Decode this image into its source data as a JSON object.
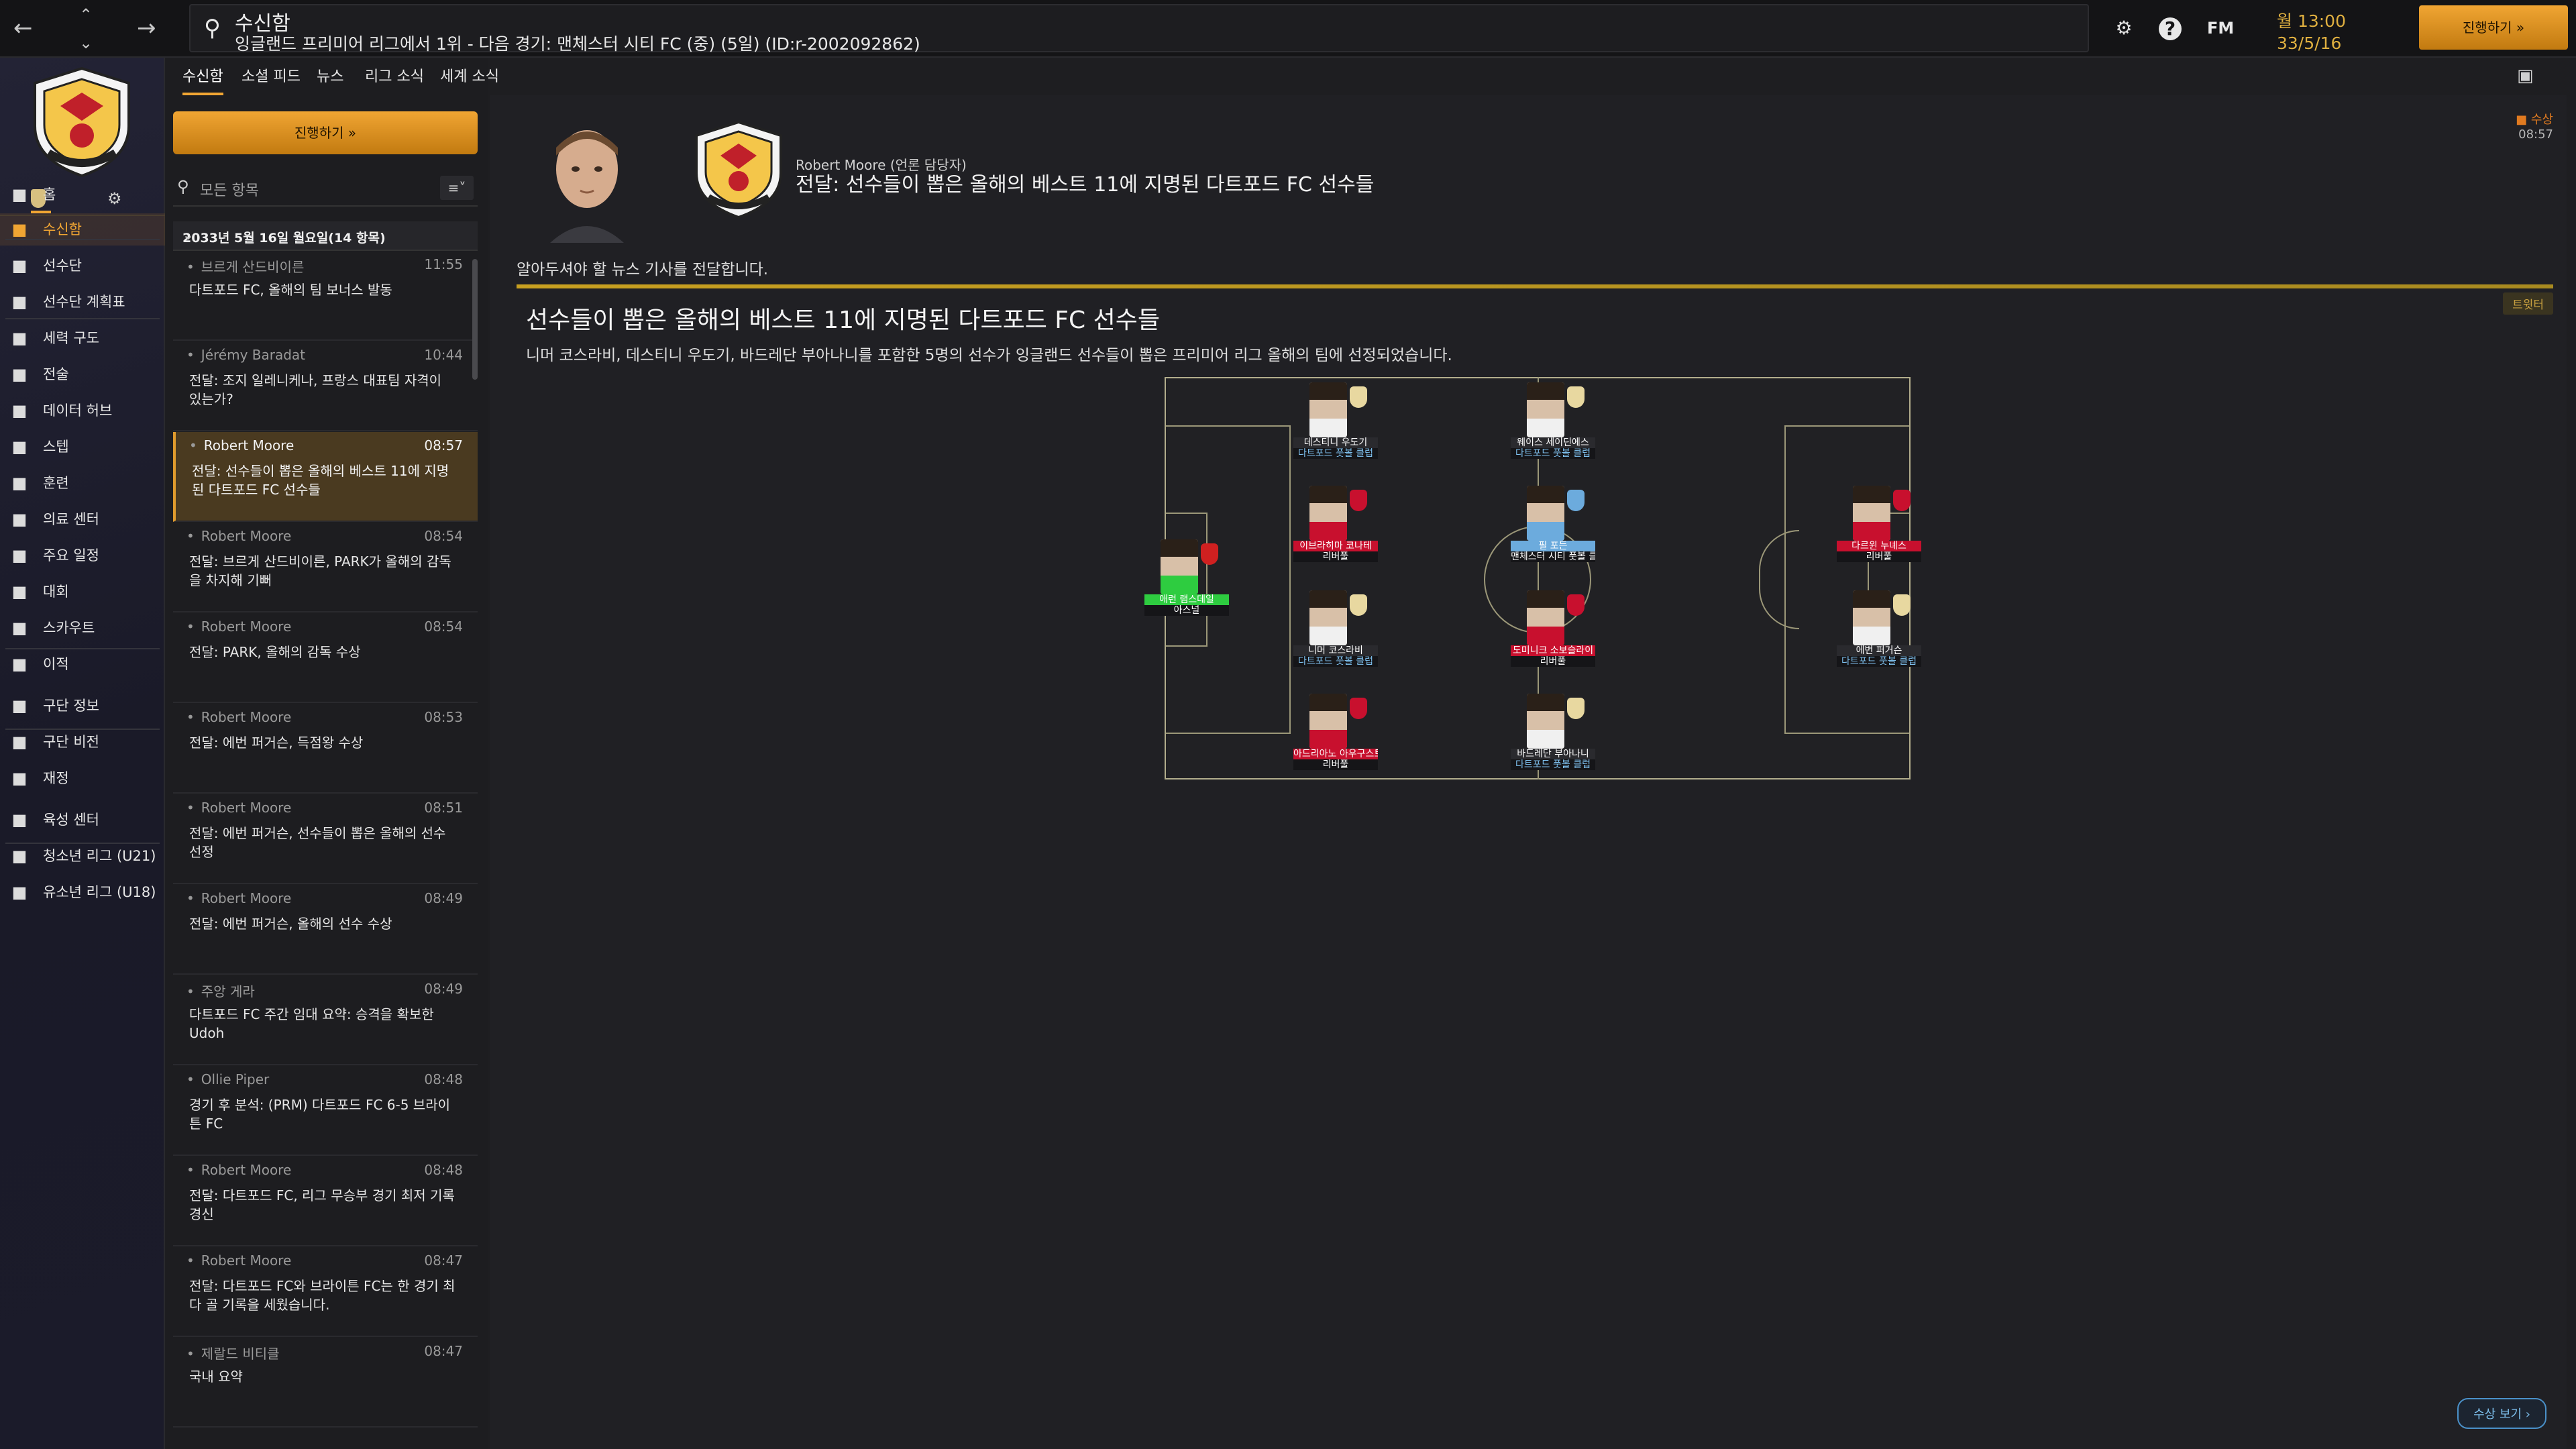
{
  "topbar": {
    "title": "수신함",
    "subtitle": "잉글랜드 프리미어 리그에서 1위 - 다음 경기: 맨체스터 시티 FC (중) (5일) (ID:r-2002092862)",
    "fm_logo": "FM",
    "date_time": "월 13:00",
    "date_day": "33/5/16",
    "continue_label": "진행하기 »"
  },
  "nav": {
    "items": [
      {
        "label": "홈",
        "icon": "home-icon"
      },
      {
        "label": "수신함",
        "icon": "inbox-icon"
      },
      {
        "label": "선수단",
        "icon": "shirt-icon"
      },
      {
        "label": "선수단 계획표",
        "icon": "clipboard-icon"
      },
      {
        "label": "세력 구도",
        "icon": "dynamics-icon"
      },
      {
        "label": "전술",
        "icon": "tactics-icon"
      },
      {
        "label": "데이터 허브",
        "icon": "data-icon"
      },
      {
        "label": "스텝",
        "icon": "staff-icon"
      },
      {
        "label": "훈련",
        "icon": "training-icon"
      },
      {
        "label": "의료 센터",
        "icon": "medical-icon"
      },
      {
        "label": "주요 일정",
        "icon": "calendar-icon"
      },
      {
        "label": "대회",
        "icon": "trophy-icon"
      },
      {
        "label": "스카우트",
        "icon": "scout-icon"
      },
      {
        "label": "이적",
        "icon": "transfer-icon"
      },
      {
        "label": "구단 정보",
        "icon": "shield-icon"
      },
      {
        "label": "구단 비전",
        "icon": "vision-icon"
      },
      {
        "label": "재정",
        "icon": "finance-icon"
      },
      {
        "label": "육성 센터",
        "icon": "development-icon"
      },
      {
        "label": "청소년 리그 (U21)",
        "icon": "u21-icon"
      },
      {
        "label": "유소년 리그 (U18)",
        "icon": "u18-icon"
      }
    ]
  },
  "subtabs": [
    "수신함",
    "소셜 피드",
    "뉴스",
    "리그 소식",
    "세계 소식"
  ],
  "inbox": {
    "continue_label": "진행하기 »",
    "filter_label": "모든 항목",
    "date_header": "2033년 5월 16일 월요일(14 항목)",
    "messages": [
      {
        "sender": "브르게 산드비이른",
        "time": "11:55",
        "subject": "다트포드 FC, 올해의 팀 보너스 발동"
      },
      {
        "sender": "Jérémy Baradat",
        "time": "10:44",
        "subject": "전달: 조지 일레니케나, 프랑스 대표팀 자격이 있는가?"
      },
      {
        "sender": "Robert Moore",
        "time": "08:57",
        "subject": "전달: 선수들이 뽑은 올해의 베스트 11에 지명된 다트포드 FC 선수들"
      },
      {
        "sender": "Robert Moore",
        "time": "08:54",
        "subject": "전달: 브르게 산드비이른, PARK가 올해의 감독을 차지해 기뻐"
      },
      {
        "sender": "Robert Moore",
        "time": "08:54",
        "subject": "전달: PARK, 올해의 감독 수상"
      },
      {
        "sender": "Robert Moore",
        "time": "08:53",
        "subject": "전달: 에번 퍼거슨, 득점왕 수상"
      },
      {
        "sender": "Robert Moore",
        "time": "08:51",
        "subject": "전달: 에번 퍼거슨, 선수들이 뽑은 올해의 선수 선정"
      },
      {
        "sender": "Robert Moore",
        "time": "08:49",
        "subject": "전달: 에번 퍼거슨, 올해의 선수 수상"
      },
      {
        "sender": "주앙 게라",
        "time": "08:49",
        "subject": "다트포드 FC 주간 임대 요약: 승격을 확보한 Udoh"
      },
      {
        "sender": "Ollie Piper",
        "time": "08:48",
        "subject": "경기 후 분석: (PRM) 다트포드 FC 6-5 브라이튼 FC"
      },
      {
        "sender": "Robert Moore",
        "time": "08:48",
        "subject": "전달: 다트포드 FC, 리그 무승부 경기 최저 기록 경신"
      },
      {
        "sender": "Robert Moore",
        "time": "08:47",
        "subject": "전달: 다트포드 FC와 브라이튼 FC는 한 경기 최다 골 기록을 세웠습니다."
      },
      {
        "sender": "제랄드 비티클",
        "time": "08:47",
        "subject": "국내 요약"
      }
    ]
  },
  "message": {
    "from": "Robert Moore (언론 담당자)",
    "subject": "전달: 선수들이 뽑은 올해의 베스트 11에 지명된 다트포드 FC 선수들",
    "tag": "수상",
    "tag_time": "08:57",
    "intro": "알아두셔야 할 뉴스 기사를 전달합니다.",
    "tweet_tag": "트윗터",
    "article_title": "선수들이 뽑은 올해의 베스트 11에 지명된 다트포드 FC 선수들",
    "article_text": "니머 코스라비, 데스티니 우도기, 바드레단 부아나니를 포함한 5명의 선수가 잉글랜드 선수들이 뽑은 프리미어 리그 올해의 팀에 선정되었습니다.",
    "show_prize_label": "수상 보기 ›"
  },
  "best_eleven": [
    {
      "name": "애런 램스데일",
      "club": "아스널",
      "shirt": "#2ecc40",
      "crest": "#d02020"
    },
    {
      "name": "데스티니 우도기",
      "club": "다트포드 풋볼 클럽",
      "shirt": "#f0f0f0",
      "crest": "#e8d8a0"
    },
    {
      "name": "이브라히마 코나테",
      "club": "리버풀",
      "shirt": "#c8102e",
      "crest": "#c8102e"
    },
    {
      "name": "니머 코스라비",
      "club": "다트포드 풋볼 클럽",
      "shirt": "#f0f0f0",
      "crest": "#e8d8a0"
    },
    {
      "name": "아드리아노 아우구스토",
      "club": "리버풀",
      "shirt": "#c8102e",
      "crest": "#c8102e"
    },
    {
      "name": "웨이스 세이딘에스",
      "club": "다트포드 풋볼 클럽",
      "shirt": "#f0f0f0",
      "crest": "#e8d8a0"
    },
    {
      "name": "필 포든",
      "club": "맨체스터 시티 풋볼 클럽",
      "shirt": "#6cabdd",
      "crest": "#6cabdd"
    },
    {
      "name": "도미니크 소보슬라이",
      "club": "리버풀",
      "shirt": "#c8102e",
      "crest": "#c8102e"
    },
    {
      "name": "바드레단 부아나니",
      "club": "다트포드 풋볼 클럽",
      "shirt": "#f0f0f0",
      "crest": "#e8d8a0"
    },
    {
      "name": "다르윈 누녜스",
      "club": "리버풀",
      "shirt": "#c8102e",
      "crest": "#c8102e"
    },
    {
      "name": "에번 퍼거슨",
      "club": "다트포드 풋볼 클럽",
      "shirt": "#f0f0f0",
      "crest": "#e8d8a0"
    }
  ]
}
